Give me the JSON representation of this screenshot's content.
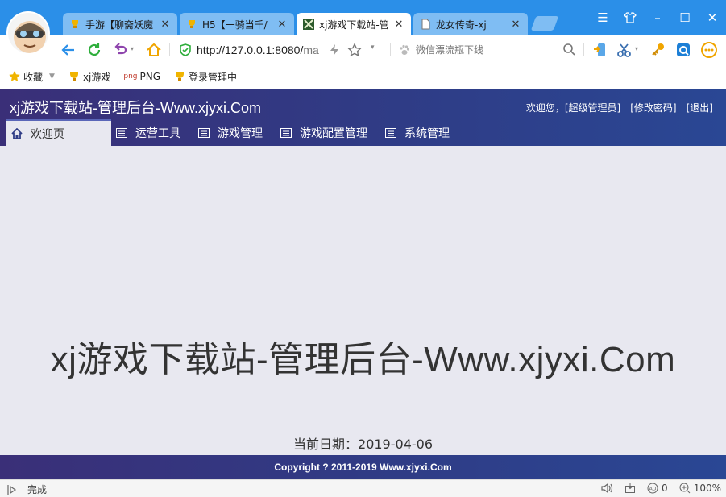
{
  "browser": {
    "tabs": [
      {
        "title": "手游【聊斋妖魔",
        "close": "✕",
        "active": false
      },
      {
        "title": "H5【一骑当千/",
        "close": "✕",
        "active": false
      },
      {
        "title": "xj游戏下载站-管",
        "close": "✕",
        "active": true
      },
      {
        "title": "龙女传奇-xj",
        "close": "✕",
        "active": false
      }
    ],
    "url": {
      "main": "http://127.0.0.1:8080/",
      "rest": "ma"
    },
    "search_placeholder": "微信漂流瓶下线",
    "bookmarks": [
      {
        "label": "收藏",
        "icon": "star-icon"
      },
      {
        "label": "xj游戏",
        "icon": "trophy-icon"
      },
      {
        "label": "PNG",
        "icon": "png-icon",
        "prefix": "png"
      },
      {
        "label": "登录管理中",
        "icon": "trophy-icon"
      }
    ],
    "status": {
      "text": "完成",
      "ad_count": "0",
      "zoom": "100%"
    }
  },
  "app": {
    "title": "xj游戏下载站-管理后台-Www.xjyxi.Com",
    "user": {
      "welcome": "欢迎您，[超级管理员]",
      "change_password": "[修改密码]",
      "logout": "[退出]"
    },
    "nav": [
      {
        "label": "欢迎页",
        "icon": "home-icon",
        "active": true
      },
      {
        "label": "运营工具",
        "icon": "list-icon",
        "active": false
      },
      {
        "label": "游戏管理",
        "icon": "list-icon",
        "active": false
      },
      {
        "label": "游戏配置管理",
        "icon": "list-icon",
        "active": false
      },
      {
        "label": "系统管理",
        "icon": "list-icon",
        "active": false
      }
    ],
    "welcome_heading": "xj游戏下载站-管理后台-Www.xjyxi.Com",
    "date_label": "当前日期：",
    "date_value": "2019-04-06",
    "copyright": "Copyright ? 2011-2019 Www.xjyxi.Com"
  },
  "colors": {
    "tab_strip": "#2b8fe8",
    "header_start": "#3a2f78",
    "header_end": "#2a4794",
    "content_bg": "#e8e8f0"
  }
}
